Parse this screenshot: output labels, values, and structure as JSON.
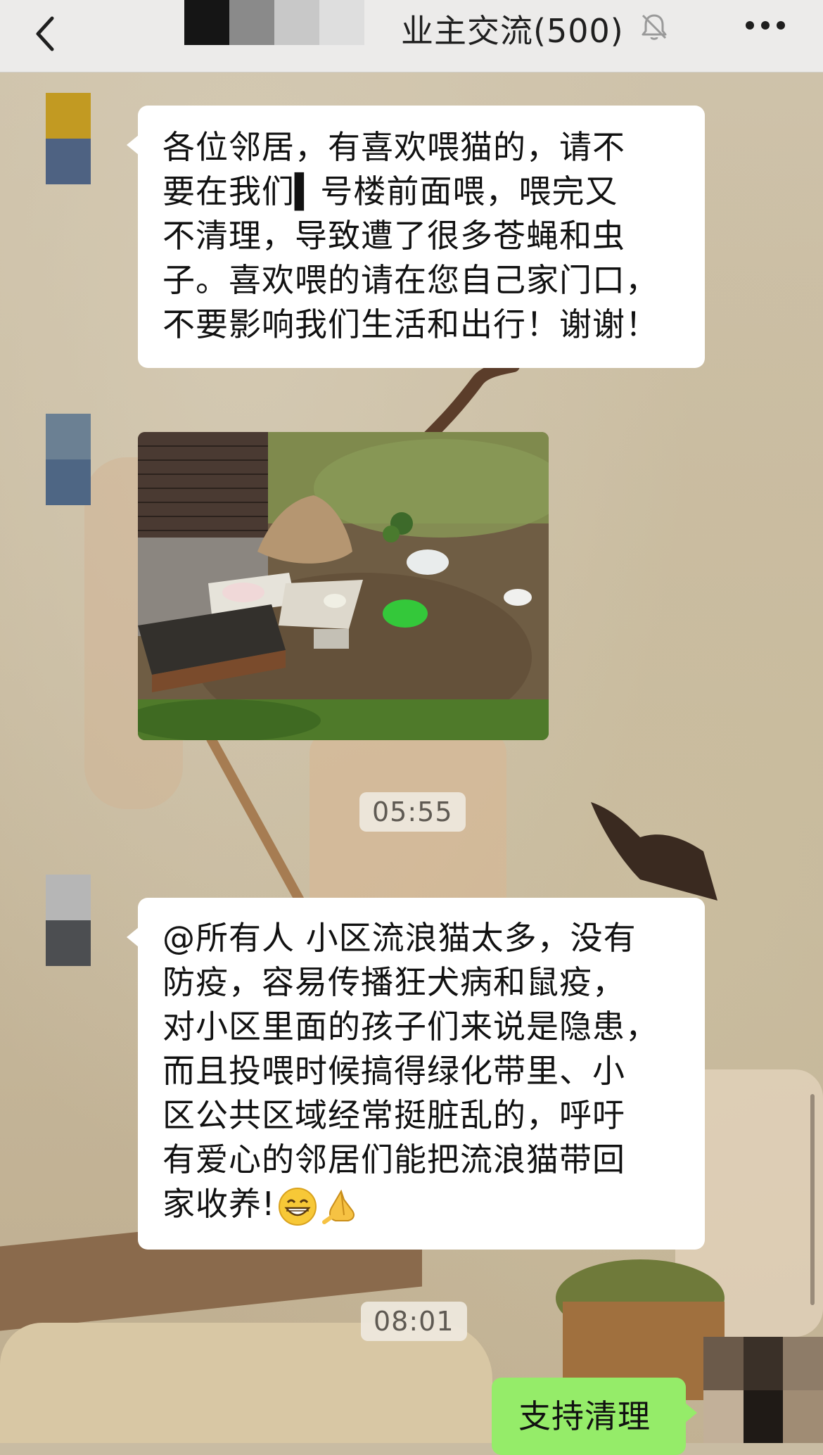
{
  "header": {
    "title": "业主交流(500)",
    "back_icon": "chevron-left-icon",
    "mute_icon": "bell-muted-icon",
    "more_icon": "more-horizontal-icon"
  },
  "messages": [
    {
      "type": "text",
      "lines": [
        "各位邻居，有喜欢喂猫的，请不",
        "要在我们▍号楼前面喂，喂完又",
        "不清理，导致遭了很多苍蝇和虫",
        "子。喜欢喂的请在您自己家门口，",
        "不要影响我们生活和出行！谢谢！"
      ]
    },
    {
      "type": "image",
      "description": ""
    },
    {
      "type": "timestamp",
      "text": "05:55"
    },
    {
      "type": "text",
      "lines": [
        "@所有人 小区流浪猫太多，没有",
        "防疫，容易传播狂犬病和鼠疫，",
        "对小区里面的孩子们来说是隐患，",
        "而且投喂时候搞得绿化带里、小",
        "区公共区域经常挺脏乱的，呼吁",
        "有爱心的邻居们能把流浪猫带回",
        "家收养!"
      ],
      "emoji": [
        "grin-emoji",
        "pray-hands-emoji"
      ]
    },
    {
      "type": "timestamp",
      "text": "08:01"
    },
    {
      "type": "text_self",
      "text": "支持清理"
    }
  ],
  "colors": {
    "bubble_incoming": "#ffffff",
    "bubble_outgoing": "#95ec69",
    "header_bg": "#ecebea"
  }
}
